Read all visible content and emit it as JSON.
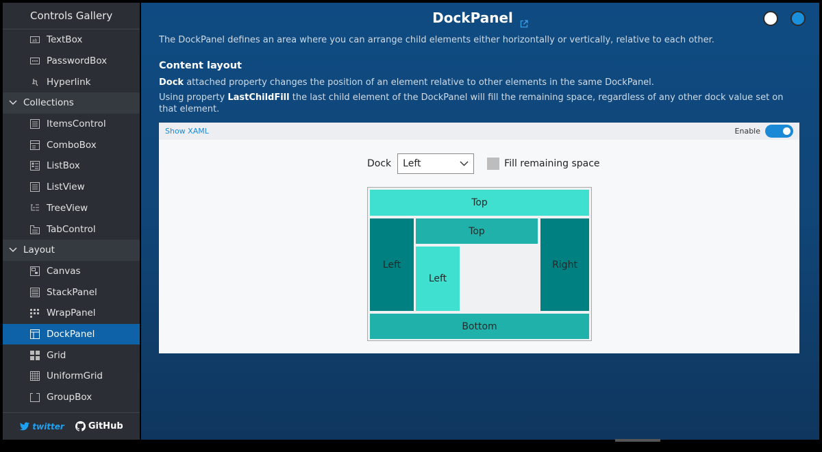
{
  "sidebar": {
    "title": "Controls Gallery",
    "items_top": [
      {
        "label": "TextBox",
        "icon": "textbox-icon"
      },
      {
        "label": "PasswordBox",
        "icon": "passwordbox-icon"
      },
      {
        "label": "Hyperlink",
        "icon": "hyperlink-icon"
      }
    ],
    "group_collections": "Collections",
    "items_collections": [
      {
        "label": "ItemsControl",
        "icon": "itemscontrol-icon"
      },
      {
        "label": "ComboBox",
        "icon": "combobox-icon"
      },
      {
        "label": "ListBox",
        "icon": "listbox-icon"
      },
      {
        "label": "ListView",
        "icon": "listview-icon"
      },
      {
        "label": "TreeView",
        "icon": "treeview-icon"
      },
      {
        "label": "TabControl",
        "icon": "tabcontrol-icon"
      }
    ],
    "group_layout": "Layout",
    "items_layout": [
      {
        "label": "Canvas",
        "icon": "canvas-icon"
      },
      {
        "label": "StackPanel",
        "icon": "stackpanel-icon"
      },
      {
        "label": "WrapPanel",
        "icon": "wrappanel-icon"
      },
      {
        "label": "DockPanel",
        "icon": "dockpanel-icon",
        "active": true
      },
      {
        "label": "Grid",
        "icon": "grid-icon"
      },
      {
        "label": "UniformGrid",
        "icon": "uniformgrid-icon"
      },
      {
        "label": "GroupBox",
        "icon": "groupbox-icon"
      }
    ],
    "footer": {
      "twitter": "twitter",
      "github": "GitHub"
    }
  },
  "main": {
    "title": "DockPanel",
    "description": "The DockPanel defines an area where you can arrange child elements either horizontally or vertically, relative to each other.",
    "section_title": "Content layout",
    "para1_bold": "Dock",
    "para1_rest": " attached property changes the position of an element relative to other elements in the same DockPanel.",
    "para2_pre": "Using property ",
    "para2_bold": "LastChildFill",
    "para2_rest": " the last child element of the DockPanel will fill the remaining space, regardless of any other dock value set on that element."
  },
  "card": {
    "show_xaml": "Show XAML",
    "enable_label": "Enable",
    "enable_on": true,
    "dock_label": "Dock",
    "dock_value": "Left",
    "fill_label": "Fill remaining space",
    "fill_checked": false
  },
  "dock_demo": {
    "top": "Top",
    "left": "Left",
    "right": "Right",
    "inner_top": "Top",
    "inner_left": "Left",
    "bottom": "Bottom"
  },
  "colors": {
    "accent": "#1b8ad6",
    "sidebar_active": "#0d62a8",
    "turquoise": "#40e0d0",
    "teal": "#008080",
    "light_sea_green": "#20b2aa"
  }
}
